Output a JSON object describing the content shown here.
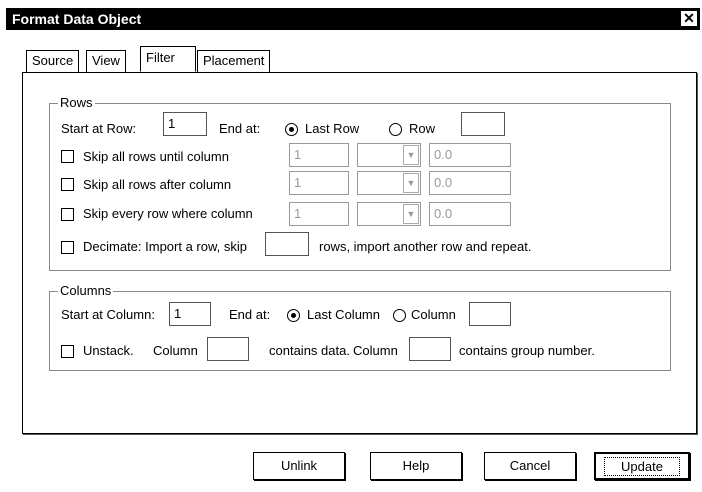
{
  "window": {
    "title": "Format Data Object",
    "close_label": "✕"
  },
  "tabs": [
    {
      "label": "Source"
    },
    {
      "label": "View"
    },
    {
      "label": "Filter"
    },
    {
      "label": "Placement"
    }
  ],
  "rows": {
    "legend": "Rows",
    "start_label": "Start at Row:",
    "start_value": "1",
    "end_label": "End at:",
    "last_row": "Last Row",
    "row": "Row",
    "row_value": "",
    "skip_until": {
      "label": "Skip all rows until column",
      "col": "1",
      "val": "0.0"
    },
    "skip_after": {
      "label": "Skip all rows after column",
      "col": "1",
      "val": "0.0"
    },
    "skip_where": {
      "label": "Skip every row where column",
      "col": "1",
      "val": "0.0"
    },
    "decimate_a": "Decimate: Import a row, skip",
    "decimate_value": "",
    "decimate_b": "rows, import another row and repeat."
  },
  "columns": {
    "legend": "Columns",
    "start_label": "Start at Column:",
    "start_value": "1",
    "end_label": "End at:",
    "last_column": "Last Column",
    "column": "Column",
    "column_value": "",
    "unstack": "Unstack.",
    "col_word": "Column",
    "contains_data": "contains data.",
    "col_word2": "Column",
    "contains_group": "contains group  number."
  },
  "buttons": {
    "unlink": "Unlink",
    "help": "Help",
    "cancel": "Cancel",
    "update": "Update"
  }
}
